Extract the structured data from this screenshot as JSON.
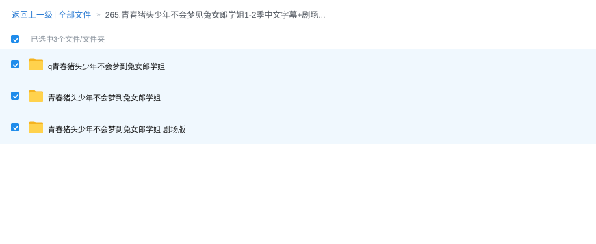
{
  "breadcrumb": {
    "back_label": "返回上一级",
    "divider": "|",
    "all_files_label": "全部文件",
    "separator": "»",
    "current_folder": "265.青春猪头少年不会梦见兔女郎学姐1-2季中文字幕+剧场..."
  },
  "selection": {
    "checked": true,
    "summary": "已选中3个文件/文件夹"
  },
  "files": [
    {
      "name": "q青春猪头少年不会梦到兔女郎学姐",
      "checked": true,
      "icon": "folder-icon"
    },
    {
      "name": "青春猪头少年不会梦到兔女郎学姐",
      "checked": true,
      "icon": "folder-icon"
    },
    {
      "name": "青春猪头少年不会梦到兔女郎学姐 剧场版",
      "checked": true,
      "icon": "folder-icon"
    }
  ],
  "colors": {
    "accent": "#1f8ceb",
    "link": "#2a7bd3",
    "row_highlight": "#f0f8fe",
    "folder": "#ffc83d"
  }
}
